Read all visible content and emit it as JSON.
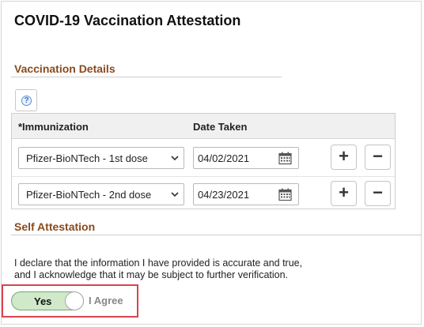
{
  "page": {
    "title": "COVID-19 Vaccination Attestation"
  },
  "vaccination_details": {
    "title": "Vaccination Details",
    "help_glyph": "?",
    "columns": {
      "immunization": "*Immunization",
      "date_taken": "Date Taken"
    },
    "rows": [
      {
        "immunization": "Pfizer-BioNTech - 1st dose",
        "date": "04/02/2021"
      },
      {
        "immunization": "Pfizer-BioNTech - 2nd dose",
        "date": "04/23/2021"
      }
    ],
    "add_glyph": "+",
    "delete_glyph": "−"
  },
  "self_attestation": {
    "title": "Self Attestation",
    "declaration_line1": "I declare that the information I have provided is accurate and true,",
    "declaration_line2": "and I acknowledge that it may be subject to further verification.",
    "toggle_value": "Yes",
    "toggle_label": "I Agree"
  },
  "colors": {
    "section_title": "#8a4a1c",
    "toggle_on": "#cfe9c9",
    "highlight_border": "#d9434f"
  }
}
